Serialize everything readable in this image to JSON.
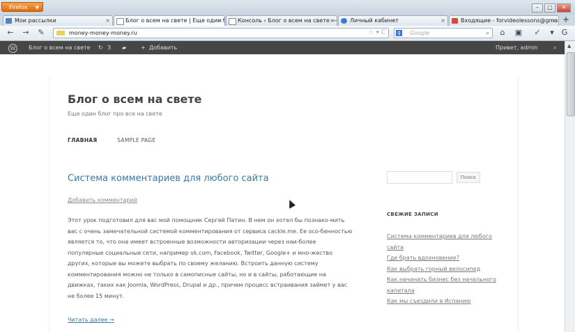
{
  "browser": {
    "app_button": "Firefox",
    "tabs": [
      {
        "label": "Мои рассылки",
        "color": "#5b7fc0"
      },
      {
        "label": "Блог о всем на свете | Еще один бл...",
        "color": "#ffffff"
      },
      {
        "label": "Консоль ‹ Блог о всем на свете — ...",
        "color": "#ffffff"
      },
      {
        "label": "Личный кабинет",
        "color": "#3d7ccf"
      },
      {
        "label": "Входящие - forvideolessons@gmail....",
        "color": "#d54a3b"
      }
    ],
    "url": "money-money-money.ru",
    "search_placeholder": "Google"
  },
  "adminbar": {
    "site_name": "Блог о всем на свете",
    "updates": "3",
    "add_new": "Добавить",
    "greeting": "Привет, admin"
  },
  "site": {
    "title": "Блог о всем на свете",
    "description": "Еще один блог про все на свете",
    "menu": [
      "ГЛАВНАЯ",
      "SAMPLE PAGE"
    ]
  },
  "post": {
    "title": "Система комментариев для любого сайта",
    "comment_link": "Добавить комментарий",
    "body": "Этот урок подготовил для вас мой помощник Сергей Патин. В нем он хотел бы познако-мить вас с очень замечательной системой комментирования от сервиса cackle.me. Ее осо-бенностью является то, что она имеет встроенные возможности авторизации через наи-более популярные социальные сети, например vk.com, Facebook, Twitter, Google+ и мно-жество других, которые вы можете выбрать по своему желанию. Встроить данную систему комментирования можно не только в самописные сайты, но и в сайты, работающие на движках, таких как Joomla, WordPress, Drupal и др., причем процесс встраивания займет у вас не более 15 минут.",
    "read_more": "Читать далее →"
  },
  "sidebar": {
    "search_button": "Поиск",
    "recent_heading": "СВЕЖИЕ ЗАПИСИ",
    "recent": [
      "Система комментариев для любого сайта",
      "Где брать вдохновение?",
      "Как выбрать горный велосипед",
      "Как начинать бизнес без начального капитала",
      "Как мы съездили в Испанию"
    ]
  }
}
